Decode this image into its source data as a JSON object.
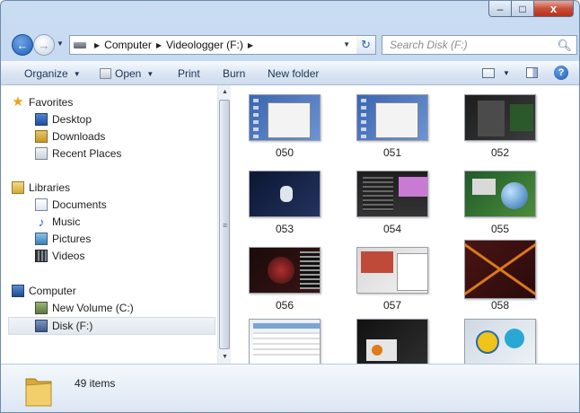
{
  "window": {
    "controls": {
      "minimize": "–",
      "maximize": "□",
      "close": "x"
    }
  },
  "navigation": {
    "back_icon": "←",
    "forward_icon": "→",
    "breadcrumb": [
      "Computer",
      "Videologger (F:)"
    ],
    "refresh_icon": "↻",
    "search_placeholder": "Search Disk (F:)"
  },
  "toolbar": {
    "organize": "Organize",
    "open": "Open",
    "print": "Print",
    "burn": "Burn",
    "new_folder": "New folder",
    "help": "?"
  },
  "sidebar": {
    "favorites": {
      "label": "Favorites",
      "items": [
        "Desktop",
        "Downloads",
        "Recent Places"
      ]
    },
    "libraries": {
      "label": "Libraries",
      "items": [
        "Documents",
        "Music",
        "Pictures",
        "Videos"
      ]
    },
    "computer": {
      "label": "Computer",
      "items": [
        "New Volume (C:)",
        "Disk (F:)"
      ]
    },
    "selected": "Disk (F:)"
  },
  "files": [
    {
      "name": "050",
      "style": "desktop-blue"
    },
    {
      "name": "051",
      "style": "desktop-blue"
    },
    {
      "name": "052",
      "style": "dark-multi"
    },
    {
      "name": "053",
      "style": "dark-navy"
    },
    {
      "name": "054",
      "style": "dark-grid"
    },
    {
      "name": "055",
      "style": "green-globe"
    },
    {
      "name": "056",
      "style": "dark-red"
    },
    {
      "name": "057",
      "style": "web-collage"
    },
    {
      "name": "058",
      "style": "x-pattern"
    },
    {
      "name": "",
      "style": "browser-light"
    },
    {
      "name": "",
      "style": "dark-dialog"
    },
    {
      "name": "",
      "style": "colorful-icons"
    }
  ],
  "status": {
    "item_count": "49 items"
  },
  "colors": {
    "accent": "#1f5fb8",
    "selection": "#e2e8ef",
    "toolbar_text": "#1e3557"
  }
}
